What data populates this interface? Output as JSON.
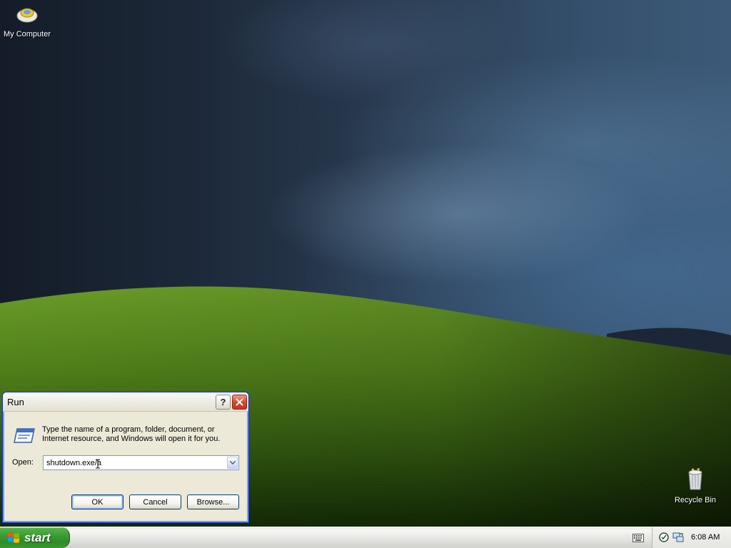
{
  "desktop": {
    "icons": [
      {
        "label": "My Computer",
        "icon": "my-computer-icon"
      },
      {
        "label": "Recycle Bin",
        "icon": "recycle-bin-icon"
      }
    ]
  },
  "run_dialog": {
    "title": "Run",
    "help_label": "?",
    "description": "Type the name of a program, folder, document, or Internet resource, and Windows will open it for you.",
    "open_label": "Open:",
    "open_value": "shutdown.exe/a",
    "ok_label": "OK",
    "cancel_label": "Cancel",
    "browse_label": "Browse..."
  },
  "taskbar": {
    "start_label": "start",
    "clock": "6:08 AM"
  },
  "colors": {
    "title_bar": "#ece9d8",
    "start_green": "#3c9a33",
    "close_red": "#d9482c"
  }
}
